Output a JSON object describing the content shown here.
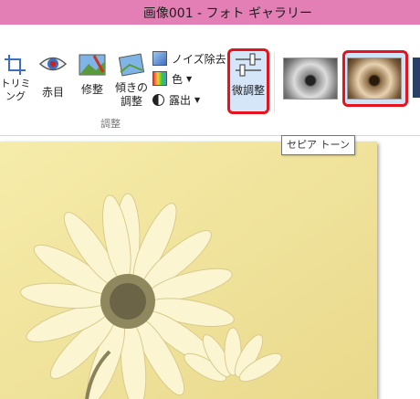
{
  "window": {
    "title": "画像001 - フォト ギャラリー",
    "accent": "#e37fb5"
  },
  "ribbon": {
    "tools": {
      "trim": "トリミング",
      "redeye": "赤目",
      "repair": "修整",
      "straighten_line1": "傾きの",
      "straighten_line2": "調整"
    },
    "small": {
      "noise": "ノイズ除去",
      "color": "色",
      "exposure": "露出"
    },
    "group_label": "調整",
    "fine_tune": "微調整"
  },
  "effects": {
    "tooltip": "セピア トーン",
    "selected": "セピア トーン"
  },
  "colors": {
    "selection": "#e4141e",
    "highlight": "#d5e6f8",
    "sepia": "#f4e9a6"
  }
}
